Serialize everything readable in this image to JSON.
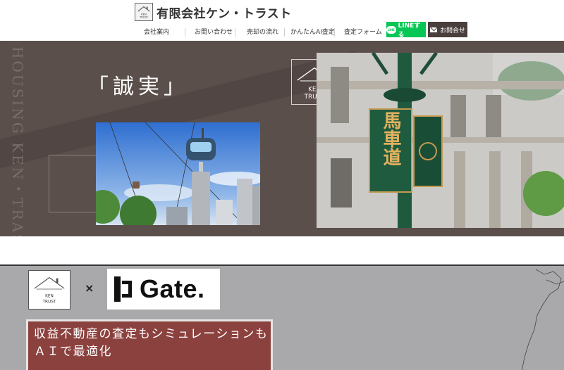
{
  "header": {
    "company_name": "有限会社ケン・トラスト",
    "logo_text": [
      "KEN",
      "TRUST"
    ],
    "nav": [
      "会社案内",
      "お問い合わせ",
      "売却の流れ",
      "かんたんAI査定",
      "査定フォーム"
    ],
    "line_button": "LINEする",
    "line_icon_text": "LINE",
    "contact_button": "お問合せ"
  },
  "hero": {
    "vertical_text": "HOUSING KEN・TRAST",
    "tagline": "「誠実」",
    "badge_text": [
      "KEN",
      "TRUST"
    ],
    "sign_text": "馬車道"
  },
  "partners": {
    "ken_logo_text": [
      "KEN",
      "TRUST"
    ],
    "times": "×",
    "gate_name": "Gate."
  },
  "promo": {
    "line1": "収益不動産の査定もシミュレーションも",
    "line2": "ＡＩで最適化"
  },
  "colors": {
    "hero_bg": "#5b4f4b",
    "line_green": "#06c755",
    "contact_bg": "#4a3f3c",
    "promo_bg": "#8b413e",
    "panel_gray": "#a9a9ac"
  }
}
